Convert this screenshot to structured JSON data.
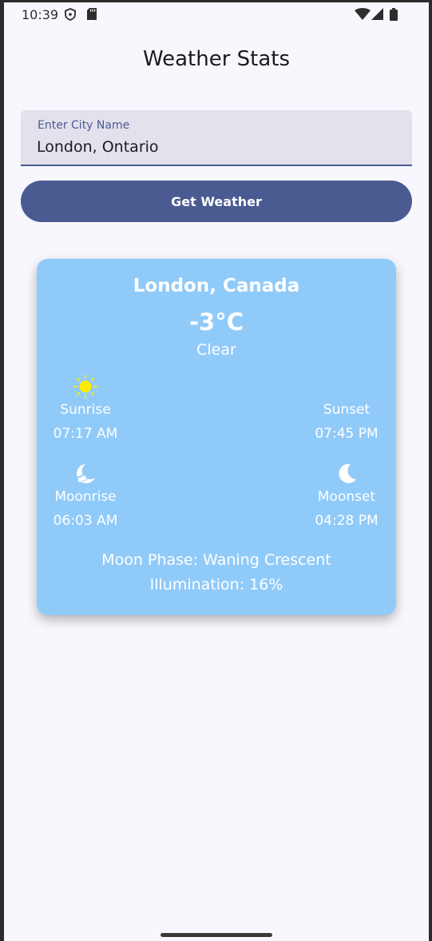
{
  "status_bar": {
    "time": "10:39"
  },
  "app": {
    "title": "Weather Stats"
  },
  "search": {
    "label": "Enter City Name",
    "value": "London, Ontario"
  },
  "actions": {
    "get_weather": "Get Weather"
  },
  "weather": {
    "city": "London, Canada",
    "temperature": "-3°C",
    "condition": "Clear",
    "sunrise": {
      "label": "Sunrise",
      "time": "07:17 AM"
    },
    "sunset": {
      "label": "Sunset",
      "time": "07:45 PM"
    },
    "moonrise": {
      "label": "Moonrise",
      "time": "06:03 AM"
    },
    "moonset": {
      "label": "Moonset",
      "time": "04:28 PM"
    },
    "moon_phase": "Moon Phase: Waning Crescent",
    "illumination": "Illumination: 16%"
  },
  "icons": {
    "sunrise": "sun-icon",
    "sunset": "crescent-moon-icon",
    "moonrise": "moon-cloud-icon",
    "moonset": "crescent-moon-icon"
  },
  "colors": {
    "primary": "#4a5b92",
    "card": "#90caf9",
    "accent_icon": "#ffeb00",
    "background": "#f8f7fd"
  }
}
